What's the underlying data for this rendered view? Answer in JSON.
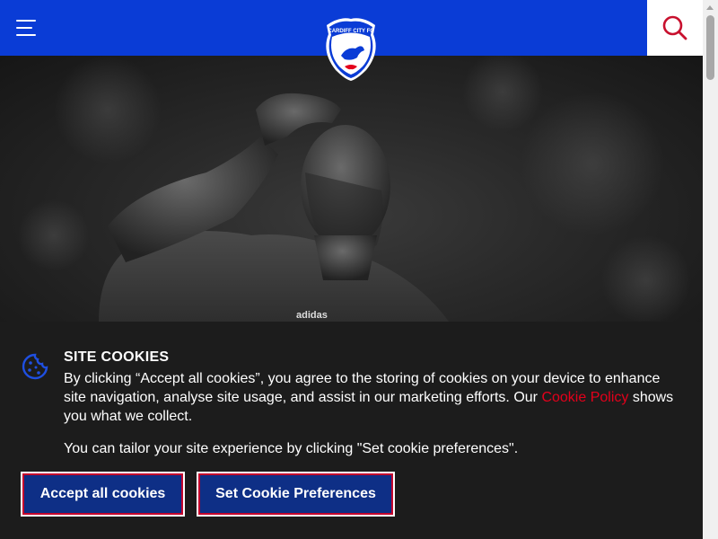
{
  "header": {
    "logo_text": "CARDIFF CITY FC",
    "menu_icon": "hamburger-menu-icon",
    "search_icon": "search-icon",
    "brand_color": "#0a3cd6",
    "accent_color": "#e4001b"
  },
  "hero": {
    "image": "black-and-white photo of a player saluting",
    "kit_text": "adidas"
  },
  "cookies": {
    "title": "SITE COOKIES",
    "text_before_link": "By clicking “Accept all cookies”, you agree to the storing of cookies on your device to enhance site navigation, analyse site usage, and assist in our marketing efforts. Our ",
    "link_text": "Cookie Policy",
    "text_after_link": " shows you what we collect.",
    "tailor_text": "You can tailor your site experience by clicking \"Set cookie preferences\".",
    "accept_label": "Accept all cookies",
    "prefs_label": "Set Cookie Preferences"
  }
}
